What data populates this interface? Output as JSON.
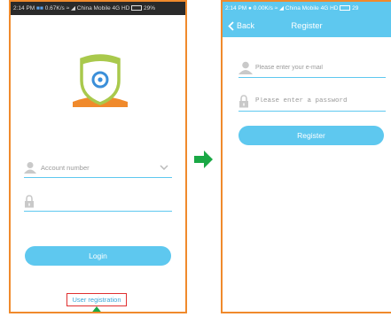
{
  "left_screen": {
    "status_bar": {
      "time": "2:14 PM",
      "speed": "0.67K/s",
      "carrier": "China Mobile",
      "network": "4G HD",
      "battery": "29%"
    },
    "account_field": {
      "placeholder": "Account number"
    },
    "password_field": {
      "placeholder": ""
    },
    "login_button": {
      "label": "Login"
    },
    "user_registration_link": {
      "label": "User registration"
    }
  },
  "right_screen": {
    "status_bar": {
      "time": "2:14 PM",
      "speed": "0.00K/s",
      "carrier": "China Mobile",
      "network": "4G HD",
      "battery": "29"
    },
    "nav": {
      "back_label": "Back",
      "title": "Register"
    },
    "email_field": {
      "placeholder": "Please enter your e-mail"
    },
    "password_field": {
      "placeholder": "Please enter a password"
    },
    "register_button": {
      "label": "Register"
    }
  },
  "colors": {
    "accent_blue": "#5ec8ef",
    "frame_orange": "#f08a2c",
    "arrow_green": "#1aa845",
    "highlight_red": "#e03030"
  }
}
